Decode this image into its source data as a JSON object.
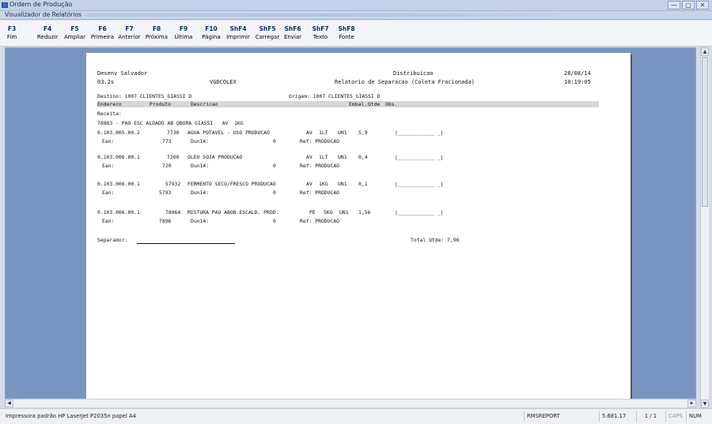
{
  "window": {
    "outer_title": "Ordem de Produção",
    "inner_title": "Visualizador de Relatórios",
    "controls": [
      "—",
      "▢",
      "✕"
    ]
  },
  "toolbar": [
    {
      "key": "F3",
      "label": "Fim"
    },
    {
      "key": "F4",
      "label": "Reduzir"
    },
    {
      "key": "F5",
      "label": "Ampliar"
    },
    {
      "key": "F6",
      "label": "Primeira"
    },
    {
      "key": "F7",
      "label": "Anterior"
    },
    {
      "key": "F8",
      "label": "Próxima"
    },
    {
      "key": "F9",
      "label": "Última"
    },
    {
      "key": "F10",
      "label": "Página"
    },
    {
      "key": "ShF4",
      "label": "Imprimir"
    },
    {
      "key": "ShF5",
      "label": "Carregar"
    },
    {
      "key": "ShF6",
      "label": "Enviar"
    },
    {
      "key": "ShF7",
      "label": "Texto"
    },
    {
      "key": "ShF8",
      "label": "Fonte"
    }
  ],
  "report": {
    "company": "Desenv Salvador",
    "branch": "03.2s",
    "program": "VGDCOLEX",
    "module": "Distribuicao",
    "title": "Relatorio de Separacao (Coleta Fracionada)",
    "date": "28/08/14",
    "time": "10:19:05",
    "destino": "Destino: 1007 CLIENTES_GIASSI D",
    "origem": "Origem: 1007 CLIENTES_GIASSI D",
    "col_headers": [
      "Endereco",
      "Produto",
      "Descricao",
      "Embal.",
      "Qtde",
      "Obs."
    ],
    "receita_label": "Receita:",
    "receita": "78883 - PAO ESC ALDADO AB OBORA GIASSI   AV  1KG",
    "items": [
      {
        "endereco": "0.103.005.00.2",
        "produto": "7730",
        "descricao": "AGUA POTAVEL - USO PRODUCAO",
        "emb1": "AV",
        "emb2": "1LT",
        "un": "UN1",
        "qtde": "5,9",
        "obs": "|____________ _|",
        "ean_label": "Ean:",
        "ean": "773",
        "dun_label": "Dun14:",
        "dun": "0",
        "ref": "Ref: PRODUCAO"
      },
      {
        "endereco": "0.103.006.00.1",
        "produto": "7200",
        "descricao": "OLEO SOJA PRODUCAO",
        "emb1": "AV",
        "emb2": "1LT",
        "un": "UN1",
        "qtde": "0,4",
        "obs": "|____________ _|",
        "ean_label": "Ean:",
        "ean": "720",
        "dun_label": "Dun14:",
        "dun": "0",
        "ref": "Ref: PRODUCAO"
      },
      {
        "endereco": "0.103.006.00.1",
        "produto": "57932",
        "descricao": "FERMENTO SECO/FRESCO PRODUCAO",
        "emb1": "AV",
        "emb2": "1KG",
        "un": "UN1",
        "qtde": "0,1",
        "obs": "|____________ _|",
        "ean_label": "Ean:",
        "ean": "5793",
        "dun_label": "Dun14:",
        "dun": "0",
        "ref": "Ref: PRODUCAO"
      },
      {
        "endereco": "0.103.006.00.1",
        "produto": "78964",
        "descricao": "MISTURA PAO ABOB.ESCALD. PROD.",
        "emb1": "PE",
        "emb2": "5KG",
        "un": "UN1",
        "qtde": "1,56",
        "obs": "|____________ _|",
        "ean_label": "Ean:",
        "ean": "7896",
        "dun_label": "Dun14:",
        "dun": "0",
        "ref": "Ref: PRODUCAO"
      }
    ],
    "separador_label": "Separador:",
    "total": "Total Qtde: 7,96"
  },
  "status": {
    "printer": "Impressora padrão HP LaserJet P2035n papel A4",
    "report_name": "RMSREPORT",
    "version": "5.681.17",
    "pages": "1 / 1",
    "caps": "CAPS",
    "num": "NUM"
  },
  "colors": {
    "workspace": "#7895c2",
    "key_text": "#0d2c6f"
  }
}
